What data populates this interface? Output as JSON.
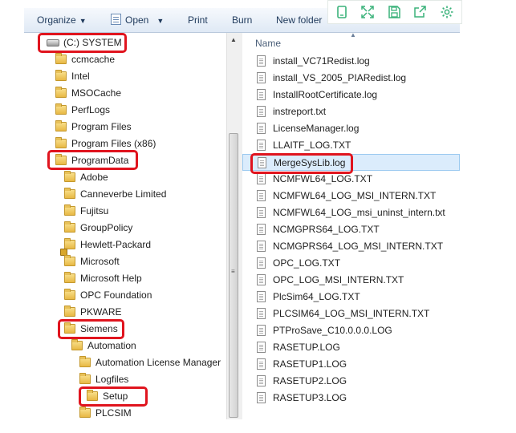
{
  "toolbar": {
    "organize": "Organize",
    "open": "Open",
    "print": "Print",
    "burn": "Burn",
    "new_folder": "New folder"
  },
  "tree": {
    "items": [
      {
        "label": "(C:) SYSTEM",
        "icon": "drive-icon",
        "depth": 0
      },
      {
        "label": "ccmcache",
        "icon": "folder-icon",
        "depth": 1
      },
      {
        "label": "Intel",
        "icon": "folder-icon",
        "depth": 1
      },
      {
        "label": "MSOCache",
        "icon": "folder-icon",
        "depth": 1
      },
      {
        "label": "PerfLogs",
        "icon": "folder-icon",
        "depth": 1
      },
      {
        "label": "Program Files",
        "icon": "folder-icon",
        "depth": 1
      },
      {
        "label": "Program Files (x86)",
        "icon": "folder-icon",
        "depth": 1
      },
      {
        "label": "ProgramData",
        "icon": "folder-icon",
        "depth": 1
      },
      {
        "label": "Adobe",
        "icon": "folder-icon",
        "depth": 2
      },
      {
        "label": "Canneverbe Limited",
        "icon": "folder-icon",
        "depth": 2
      },
      {
        "label": "Fujitsu",
        "icon": "folder-icon",
        "depth": 2
      },
      {
        "label": "GroupPolicy",
        "icon": "folder-icon",
        "depth": 2
      },
      {
        "label": "Hewlett-Packard",
        "icon": "locked-folder-icon",
        "depth": 2
      },
      {
        "label": "Microsoft",
        "icon": "folder-icon",
        "depth": 2
      },
      {
        "label": "Microsoft Help",
        "icon": "folder-icon",
        "depth": 2
      },
      {
        "label": "OPC Foundation",
        "icon": "folder-icon",
        "depth": 2
      },
      {
        "label": "PKWARE",
        "icon": "folder-icon",
        "depth": 2
      },
      {
        "label": "Siemens",
        "icon": "folder-icon",
        "depth": 2
      },
      {
        "label": "Automation",
        "icon": "folder-icon",
        "depth": 3
      },
      {
        "label": "Automation License Manager",
        "icon": "folder-icon",
        "depth": 4
      },
      {
        "label": "Logfiles",
        "icon": "folder-icon",
        "depth": 4
      },
      {
        "label": "Setup",
        "icon": "folder-icon",
        "depth": 5
      },
      {
        "label": "PLCSIM",
        "icon": "folder-icon",
        "depth": 4
      }
    ]
  },
  "files": {
    "column_header": "Name",
    "items": [
      "install_VC71Redist.log",
      "install_VS_2005_PIARedist.log",
      "InstallRootCertificate.log",
      "instreport.txt",
      "LicenseManager.log",
      "LLAITF_LOG.TXT",
      "MergeSysLib.log",
      "NCMFWL64_LOG.TXT",
      "NCMFWL64_LOG_MSI_INTERN.TXT",
      "NCMFWL64_LOG_msi_uninst_intern.txt",
      "NCMGPRS64_LOG.TXT",
      "NCMGPRS64_LOG_MSI_INTERN.TXT",
      "OPC_LOG.TXT",
      "OPC_LOG_MSI_INTERN.TXT",
      "PlcSim64_LOG.TXT",
      "PLCSIM64_LOG_MSI_INTERN.TXT",
      "PTProSave_C10.0.0.0.LOG",
      "RASETUP.LOG",
      "RASETUP1.LOG",
      "RASETUP2.LOG",
      "RASETUP3.LOG"
    ],
    "selected": "MergeSysLib.log"
  },
  "quickbar": {
    "icons": [
      "phone-icon",
      "expand-icon",
      "save-icon",
      "share-icon",
      "settings-icon"
    ],
    "accent": "#3ab27a"
  },
  "highlight_color": "#e0141e"
}
